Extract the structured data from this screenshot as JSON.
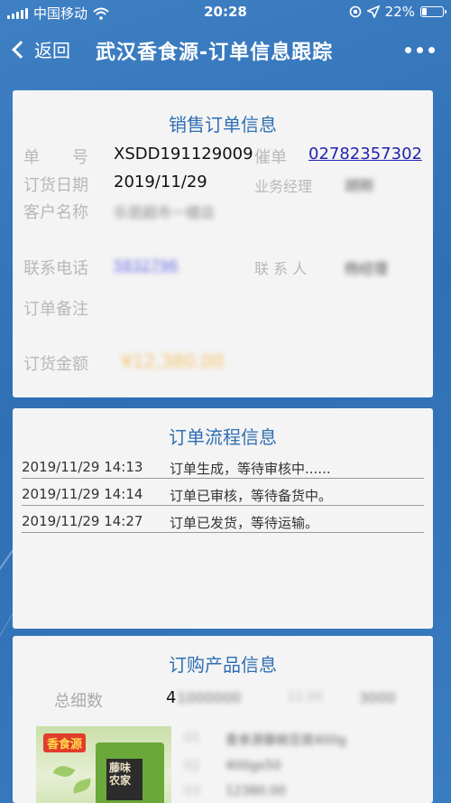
{
  "status_bar": {
    "carrier": "中国移动",
    "time": "20:28",
    "battery": "22%",
    "battery_level": 0.22
  },
  "nav": {
    "back_label": "返回",
    "title": "武汉香食源-订单信息跟踪"
  },
  "sales_order": {
    "title": "销售订单信息",
    "order_no_label": "单　　号",
    "order_no": "XSDD191129009",
    "urge_label": "催单",
    "urge_phone": "02782357302",
    "order_date_label": "订货日期",
    "order_date": "2019/11/29",
    "manager_label": "业务经理",
    "manager": "胡刚",
    "customer_label": "客户名称",
    "customer": "乐昆超市一楼店",
    "phone_label": "联系电话",
    "phone": "5832796",
    "contact_label": "联 系 人",
    "contact": "杨经理",
    "remark_label": "订单备注",
    "amount_label": "订货金额",
    "amount": "¥12,380.00"
  },
  "order_flow": {
    "title": "订单流程信息",
    "rows": [
      {
        "time": "2019/11/29 14:13",
        "desc": "订单生成，等待审核中......"
      },
      {
        "time": "2019/11/29 14:14",
        "desc": "订单已审核，等待备货中。"
      },
      {
        "time": "2019/11/29 14:27",
        "desc": "订单已发货，等待运输。"
      }
    ]
  },
  "products": {
    "title": "订购产品信息",
    "total_label": "总细数",
    "total_value": "4",
    "total_blurred_a": "1000000",
    "total_blurred_b": "12.00",
    "total_blurred_c": "3000",
    "product_brand": "香食源",
    "product_pack_text": "藤味农家",
    "item_lines": [
      "01",
      "香食源藤椒豆腐400g",
      "02",
      "400gx50",
      "03",
      "12380.00"
    ]
  }
}
